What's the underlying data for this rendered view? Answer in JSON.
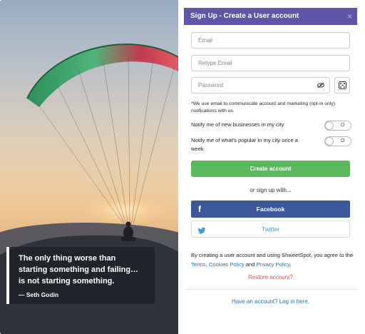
{
  "hero": {
    "quote": "The only thing worse than starting something and failing… is not starting something.",
    "author": "— Seth Godin"
  },
  "panel": {
    "title": "Sign Up - Create a User account",
    "close": "×"
  },
  "form": {
    "email_placeholder": "Email",
    "retype_email_placeholder": "Retype Email",
    "password_placeholder": "Password",
    "note": "*We use email to communicate account and marketing (opt-in only) notifications with us.",
    "toggles": [
      {
        "label": "Notify me of new businesses in my city",
        "state": "O"
      },
      {
        "label": "Notify me of what's popular in my city once a week",
        "state": "O"
      }
    ],
    "create_button": "Create account",
    "or_text": "or sign up with...",
    "facebook_button": "Facebook",
    "twitter_button": "Twitter"
  },
  "terms": {
    "prefix": "By creating a user account and using ShweetSpot, you agree to the ",
    "terms_link": "Terms",
    "sep1": ", ",
    "cookies_link": "Cookies Policy",
    "sep2": " and ",
    "privacy_link": "Privacy Policy",
    "suffix": "."
  },
  "restore_link": "Restore account?",
  "login_link": "Have an account? Log in here.",
  "colors": {
    "header": "#5d55a5",
    "create_button": "#5cb85c",
    "facebook": "#3b5998",
    "twitter": "#3a9ad9",
    "restore": "#d9534f",
    "link": "#2a6fb8"
  }
}
